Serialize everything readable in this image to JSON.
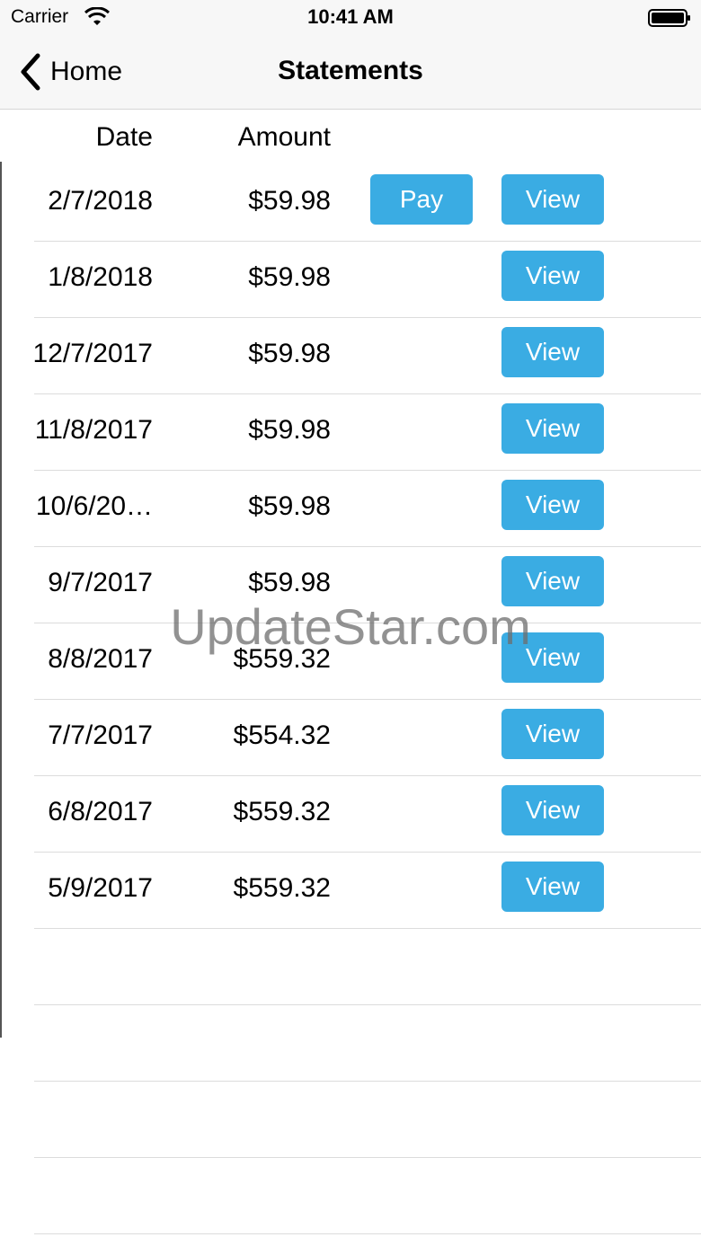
{
  "status_bar": {
    "carrier": "Carrier",
    "time": "10:41 AM"
  },
  "nav": {
    "back_label": "Home",
    "title": "Statements"
  },
  "table": {
    "headers": {
      "date": "Date",
      "amount": "Amount"
    },
    "pay_label": "Pay",
    "view_label": "View",
    "rows": [
      {
        "date": "2/7/2018",
        "amount": "$59.98",
        "has_pay": true
      },
      {
        "date": "1/8/2018",
        "amount": "$59.98",
        "has_pay": false
      },
      {
        "date": "12/7/2017",
        "amount": "$59.98",
        "has_pay": false
      },
      {
        "date": "11/8/2017",
        "amount": "$59.98",
        "has_pay": false
      },
      {
        "date": "10/6/20…",
        "amount": "$59.98",
        "has_pay": false
      },
      {
        "date": "9/7/2017",
        "amount": "$59.98",
        "has_pay": false
      },
      {
        "date": "8/8/2017",
        "amount": "$559.32",
        "has_pay": false
      },
      {
        "date": "7/7/2017",
        "amount": "$554.32",
        "has_pay": false
      },
      {
        "date": "6/8/2017",
        "amount": "$559.32",
        "has_pay": false
      },
      {
        "date": "5/9/2017",
        "amount": "$559.32",
        "has_pay": false
      }
    ],
    "empty_rows": 4
  },
  "watermark": "UpdateStar.com",
  "colors": {
    "button": "#3aace3",
    "bar_background": "#f7f7f7"
  }
}
